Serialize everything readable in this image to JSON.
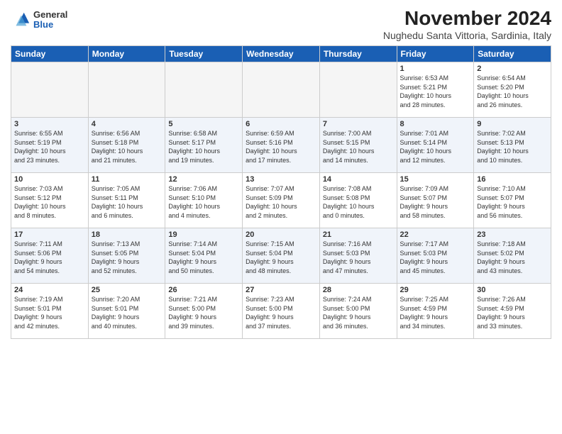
{
  "header": {
    "logo_general": "General",
    "logo_blue": "Blue",
    "title": "November 2024",
    "location": "Nughedu Santa Vittoria, Sardinia, Italy"
  },
  "days_of_week": [
    "Sunday",
    "Monday",
    "Tuesday",
    "Wednesday",
    "Thursday",
    "Friday",
    "Saturday"
  ],
  "weeks": [
    [
      {
        "day": "",
        "info": ""
      },
      {
        "day": "",
        "info": ""
      },
      {
        "day": "",
        "info": ""
      },
      {
        "day": "",
        "info": ""
      },
      {
        "day": "",
        "info": ""
      },
      {
        "day": "1",
        "info": "Sunrise: 6:53 AM\nSunset: 5:21 PM\nDaylight: 10 hours\nand 28 minutes."
      },
      {
        "day": "2",
        "info": "Sunrise: 6:54 AM\nSunset: 5:20 PM\nDaylight: 10 hours\nand 26 minutes."
      }
    ],
    [
      {
        "day": "3",
        "info": "Sunrise: 6:55 AM\nSunset: 5:19 PM\nDaylight: 10 hours\nand 23 minutes."
      },
      {
        "day": "4",
        "info": "Sunrise: 6:56 AM\nSunset: 5:18 PM\nDaylight: 10 hours\nand 21 minutes."
      },
      {
        "day": "5",
        "info": "Sunrise: 6:58 AM\nSunset: 5:17 PM\nDaylight: 10 hours\nand 19 minutes."
      },
      {
        "day": "6",
        "info": "Sunrise: 6:59 AM\nSunset: 5:16 PM\nDaylight: 10 hours\nand 17 minutes."
      },
      {
        "day": "7",
        "info": "Sunrise: 7:00 AM\nSunset: 5:15 PM\nDaylight: 10 hours\nand 14 minutes."
      },
      {
        "day": "8",
        "info": "Sunrise: 7:01 AM\nSunset: 5:14 PM\nDaylight: 10 hours\nand 12 minutes."
      },
      {
        "day": "9",
        "info": "Sunrise: 7:02 AM\nSunset: 5:13 PM\nDaylight: 10 hours\nand 10 minutes."
      }
    ],
    [
      {
        "day": "10",
        "info": "Sunrise: 7:03 AM\nSunset: 5:12 PM\nDaylight: 10 hours\nand 8 minutes."
      },
      {
        "day": "11",
        "info": "Sunrise: 7:05 AM\nSunset: 5:11 PM\nDaylight: 10 hours\nand 6 minutes."
      },
      {
        "day": "12",
        "info": "Sunrise: 7:06 AM\nSunset: 5:10 PM\nDaylight: 10 hours\nand 4 minutes."
      },
      {
        "day": "13",
        "info": "Sunrise: 7:07 AM\nSunset: 5:09 PM\nDaylight: 10 hours\nand 2 minutes."
      },
      {
        "day": "14",
        "info": "Sunrise: 7:08 AM\nSunset: 5:08 PM\nDaylight: 10 hours\nand 0 minutes."
      },
      {
        "day": "15",
        "info": "Sunrise: 7:09 AM\nSunset: 5:07 PM\nDaylight: 9 hours\nand 58 minutes."
      },
      {
        "day": "16",
        "info": "Sunrise: 7:10 AM\nSunset: 5:07 PM\nDaylight: 9 hours\nand 56 minutes."
      }
    ],
    [
      {
        "day": "17",
        "info": "Sunrise: 7:11 AM\nSunset: 5:06 PM\nDaylight: 9 hours\nand 54 minutes."
      },
      {
        "day": "18",
        "info": "Sunrise: 7:13 AM\nSunset: 5:05 PM\nDaylight: 9 hours\nand 52 minutes."
      },
      {
        "day": "19",
        "info": "Sunrise: 7:14 AM\nSunset: 5:04 PM\nDaylight: 9 hours\nand 50 minutes."
      },
      {
        "day": "20",
        "info": "Sunrise: 7:15 AM\nSunset: 5:04 PM\nDaylight: 9 hours\nand 48 minutes."
      },
      {
        "day": "21",
        "info": "Sunrise: 7:16 AM\nSunset: 5:03 PM\nDaylight: 9 hours\nand 47 minutes."
      },
      {
        "day": "22",
        "info": "Sunrise: 7:17 AM\nSunset: 5:03 PM\nDaylight: 9 hours\nand 45 minutes."
      },
      {
        "day": "23",
        "info": "Sunrise: 7:18 AM\nSunset: 5:02 PM\nDaylight: 9 hours\nand 43 minutes."
      }
    ],
    [
      {
        "day": "24",
        "info": "Sunrise: 7:19 AM\nSunset: 5:01 PM\nDaylight: 9 hours\nand 42 minutes."
      },
      {
        "day": "25",
        "info": "Sunrise: 7:20 AM\nSunset: 5:01 PM\nDaylight: 9 hours\nand 40 minutes."
      },
      {
        "day": "26",
        "info": "Sunrise: 7:21 AM\nSunset: 5:00 PM\nDaylight: 9 hours\nand 39 minutes."
      },
      {
        "day": "27",
        "info": "Sunrise: 7:23 AM\nSunset: 5:00 PM\nDaylight: 9 hours\nand 37 minutes."
      },
      {
        "day": "28",
        "info": "Sunrise: 7:24 AM\nSunset: 5:00 PM\nDaylight: 9 hours\nand 36 minutes."
      },
      {
        "day": "29",
        "info": "Sunrise: 7:25 AM\nSunset: 4:59 PM\nDaylight: 9 hours\nand 34 minutes."
      },
      {
        "day": "30",
        "info": "Sunrise: 7:26 AM\nSunset: 4:59 PM\nDaylight: 9 hours\nand 33 minutes."
      }
    ]
  ]
}
